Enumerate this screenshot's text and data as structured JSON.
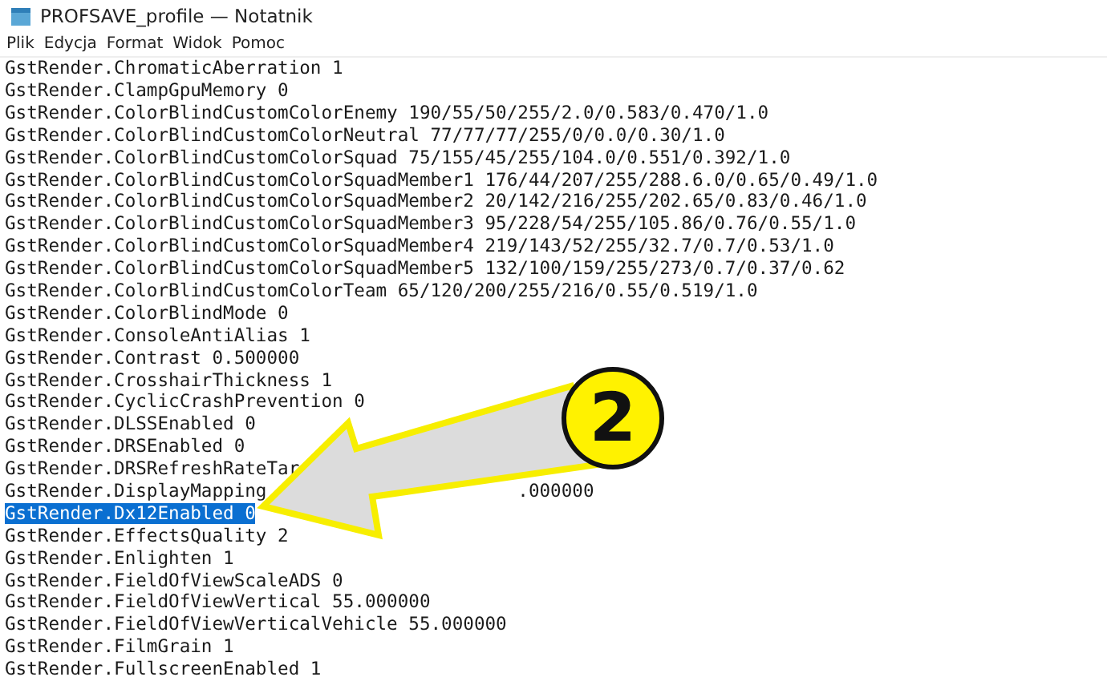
{
  "window": {
    "title": "PROFSAVE_profile — Notatnik"
  },
  "menu": [
    "Plik",
    "Edycja",
    "Format",
    "Widok",
    "Pomoc"
  ],
  "lines": [
    {
      "text": "GstRender.ChromaticAberration 1",
      "selected": false
    },
    {
      "text": "GstRender.ClampGpuMemory 0",
      "selected": false
    },
    {
      "text": "GstRender.ColorBlindCustomColorEnemy 190/55/50/255/2.0/0.583/0.470/1.0",
      "selected": false
    },
    {
      "text": "GstRender.ColorBlindCustomColorNeutral 77/77/77/255/0/0.0/0.30/1.0",
      "selected": false
    },
    {
      "text": "GstRender.ColorBlindCustomColorSquad 75/155/45/255/104.0/0.551/0.392/1.0",
      "selected": false
    },
    {
      "text": "GstRender.ColorBlindCustomColorSquadMember1 176/44/207/255/288.6.0/0.65/0.49/1.0",
      "selected": false
    },
    {
      "text": "GstRender.ColorBlindCustomColorSquadMember2 20/142/216/255/202.65/0.83/0.46/1.0",
      "selected": false
    },
    {
      "text": "GstRender.ColorBlindCustomColorSquadMember3 95/228/54/255/105.86/0.76/0.55/1.0",
      "selected": false
    },
    {
      "text": "GstRender.ColorBlindCustomColorSquadMember4 219/143/52/255/32.7/0.7/0.53/1.0",
      "selected": false
    },
    {
      "text": "GstRender.ColorBlindCustomColorSquadMember5 132/100/159/255/273/0.7/0.37/0.62",
      "selected": false
    },
    {
      "text": "GstRender.ColorBlindCustomColorTeam 65/120/200/255/216/0.55/0.519/1.0",
      "selected": false
    },
    {
      "text": "GstRender.ColorBlindMode 0",
      "selected": false
    },
    {
      "text": "GstRender.ConsoleAntiAlias 1",
      "selected": false
    },
    {
      "text": "GstRender.Contrast 0.500000",
      "selected": false
    },
    {
      "text": "GstRender.CrosshairThickness 1",
      "selected": false
    },
    {
      "text": "GstRender.CyclicCrashPrevention 0",
      "selected": false
    },
    {
      "text": "GstRender.DLSSEnabled 0",
      "selected": false
    },
    {
      "text": "GstRender.DRSEnabled 0",
      "selected": false
    },
    {
      "text": "GstRender.DRSRefreshRateTar",
      "selected": false
    },
    {
      "text": "GstRender.DisplayMapping",
      "tail": ".000000",
      "selected": false
    },
    {
      "text": "GstRender.Dx12Enabled 0",
      "selected": true
    },
    {
      "text": "GstRender.EffectsQuality 2",
      "selected": false
    },
    {
      "text": "GstRender.Enlighten 1",
      "selected": false
    },
    {
      "text": "GstRender.FieldOfViewScaleADS 0",
      "selected": false
    },
    {
      "text": "GstRender.FieldOfViewVertical 55.000000",
      "selected": false
    },
    {
      "text": "GstRender.FieldOfViewVerticalVehicle 55.000000",
      "selected": false
    },
    {
      "text": "GstRender.FilmGrain 1",
      "selected": false
    },
    {
      "text": "GstRender.FullscreenEnabled 1",
      "selected": false
    }
  ],
  "callout": {
    "number": "2"
  }
}
